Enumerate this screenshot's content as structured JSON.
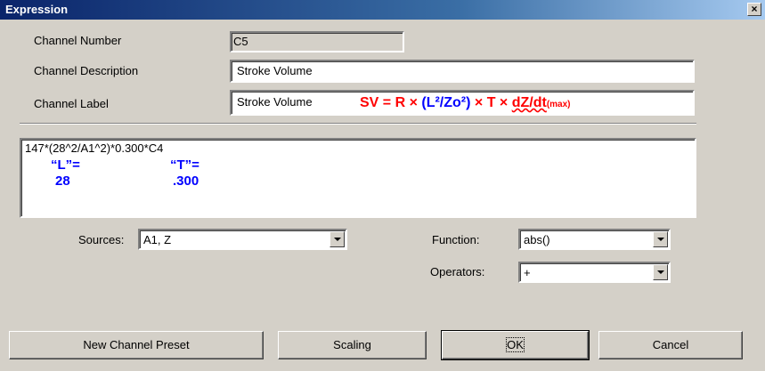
{
  "window": {
    "title": "Expression",
    "close_glyph": "×"
  },
  "fields": {
    "channel_number": {
      "label": "Channel Number",
      "value": "C5"
    },
    "channel_description": {
      "label": "Channel Description",
      "value": "Stroke Volume"
    },
    "channel_label": {
      "label": "Channel Label",
      "value": "Stroke Volume"
    }
  },
  "formula_overlay": {
    "sv": "SV = R ×",
    "l2": "(L²/Zo²)",
    "times_t": "× T ×",
    "dzdt": "dZ/dt",
    "max": "(max)"
  },
  "expression": {
    "value": "147*(28^2/A1^2)*0.300*C4",
    "annotations": [
      {
        "name": "“L”=",
        "value": "28"
      },
      {
        "name": "“T”=",
        "value": ".300"
      }
    ]
  },
  "sources": {
    "label": "Sources:",
    "value": "A1, Z"
  },
  "function": {
    "label": "Function:",
    "value": "abs()"
  },
  "operators": {
    "label": "Operators:",
    "value": "+"
  },
  "buttons": {
    "new_channel_preset": "New Channel Preset",
    "scaling": "Scaling",
    "ok": "OK",
    "cancel": "Cancel"
  },
  "colors": {
    "title_bar": "#0a246a",
    "annotation": "#0000ff",
    "formula": "#ff0000",
    "dialog_bg": "#d4d0c8"
  }
}
